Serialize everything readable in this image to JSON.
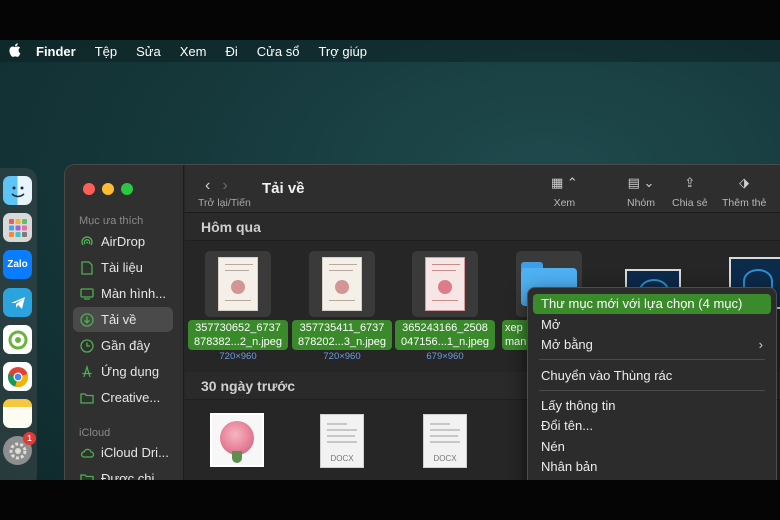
{
  "menubar": {
    "apple_icon": "apple-logo-icon",
    "items": [
      "Finder",
      "Tệp",
      "Sửa",
      "Xem",
      "Đi",
      "Cửa sổ",
      "Trợ giúp"
    ]
  },
  "dock": {
    "apps": [
      "finder-icon",
      "launchpad-icon",
      "zalo-icon",
      "telegram-icon",
      "coccoc-icon",
      "chrome-icon",
      "notes-icon",
      "system-settings-icon"
    ],
    "zalo_label": "Zalo",
    "settings_badge": "1"
  },
  "sidebar": {
    "favorites_heading": "Mục ưa thích",
    "favorites": [
      {
        "label": "AirDrop",
        "icon": "airdrop-icon"
      },
      {
        "label": "Tài liệu",
        "icon": "document-icon"
      },
      {
        "label": "Màn hình...",
        "icon": "desktop-icon"
      },
      {
        "label": "Tải về",
        "icon": "download-icon",
        "selected": true
      },
      {
        "label": "Gần đây",
        "icon": "clock-icon"
      },
      {
        "label": "Ứng dụng",
        "icon": "applications-icon"
      },
      {
        "label": "Creative...",
        "icon": "folder-icon"
      }
    ],
    "icloud_heading": "iCloud",
    "icloud": [
      {
        "label": "iCloud Dri...",
        "icon": "cloud-icon"
      },
      {
        "label": "Được chi...",
        "icon": "shared-folder-icon"
      }
    ]
  },
  "toolbar": {
    "back_forward_label": "Trở lại/Tiến",
    "title": "Tải về",
    "view_label": "Xem",
    "group_label": "Nhóm",
    "share_label": "Chia sẻ",
    "tags_label": "Thêm thẻ"
  },
  "groups": {
    "yesterday": "Hôm qua",
    "last30": "30 ngày trước"
  },
  "files_yesterday": [
    {
      "name_line1": "357730652_6737",
      "name_line2": "878382...2_n.jpeg",
      "size": "720×960"
    },
    {
      "name_line1": "357735411_6737",
      "name_line2": "878202...3_n.jpeg",
      "size": "720×960"
    },
    {
      "name_line1": "365243166_2508",
      "name_line2": "047156...1_n.jpeg",
      "size": "679×960"
    },
    {
      "name_line1": "xep",
      "name_line2": "man"
    }
  ],
  "files_last30": [
    {
      "type": "photo"
    },
    {
      "type": "docx",
      "label": "DOCX"
    },
    {
      "type": "docx",
      "label": "DOCX"
    }
  ],
  "context_menu": {
    "items": [
      {
        "label": "Thư mục mới với lựa chọn (4 mục)",
        "highlighted": true
      },
      {
        "label": "Mở"
      },
      {
        "label": "Mở bằng",
        "submenu": true
      },
      {
        "label": "Chuyển vào Thùng rác"
      },
      {
        "label": "Lấy thông tin"
      },
      {
        "label": "Đổi tên..."
      },
      {
        "label": "Nén"
      },
      {
        "label": "Nhân bản"
      }
    ],
    "highlight_color": "#3b8a2c"
  },
  "colors": {
    "selection_green": "#3a8a2b",
    "traffic_red": "#ff5f57",
    "traffic_yellow": "#febc2e",
    "traffic_green": "#28c840"
  }
}
